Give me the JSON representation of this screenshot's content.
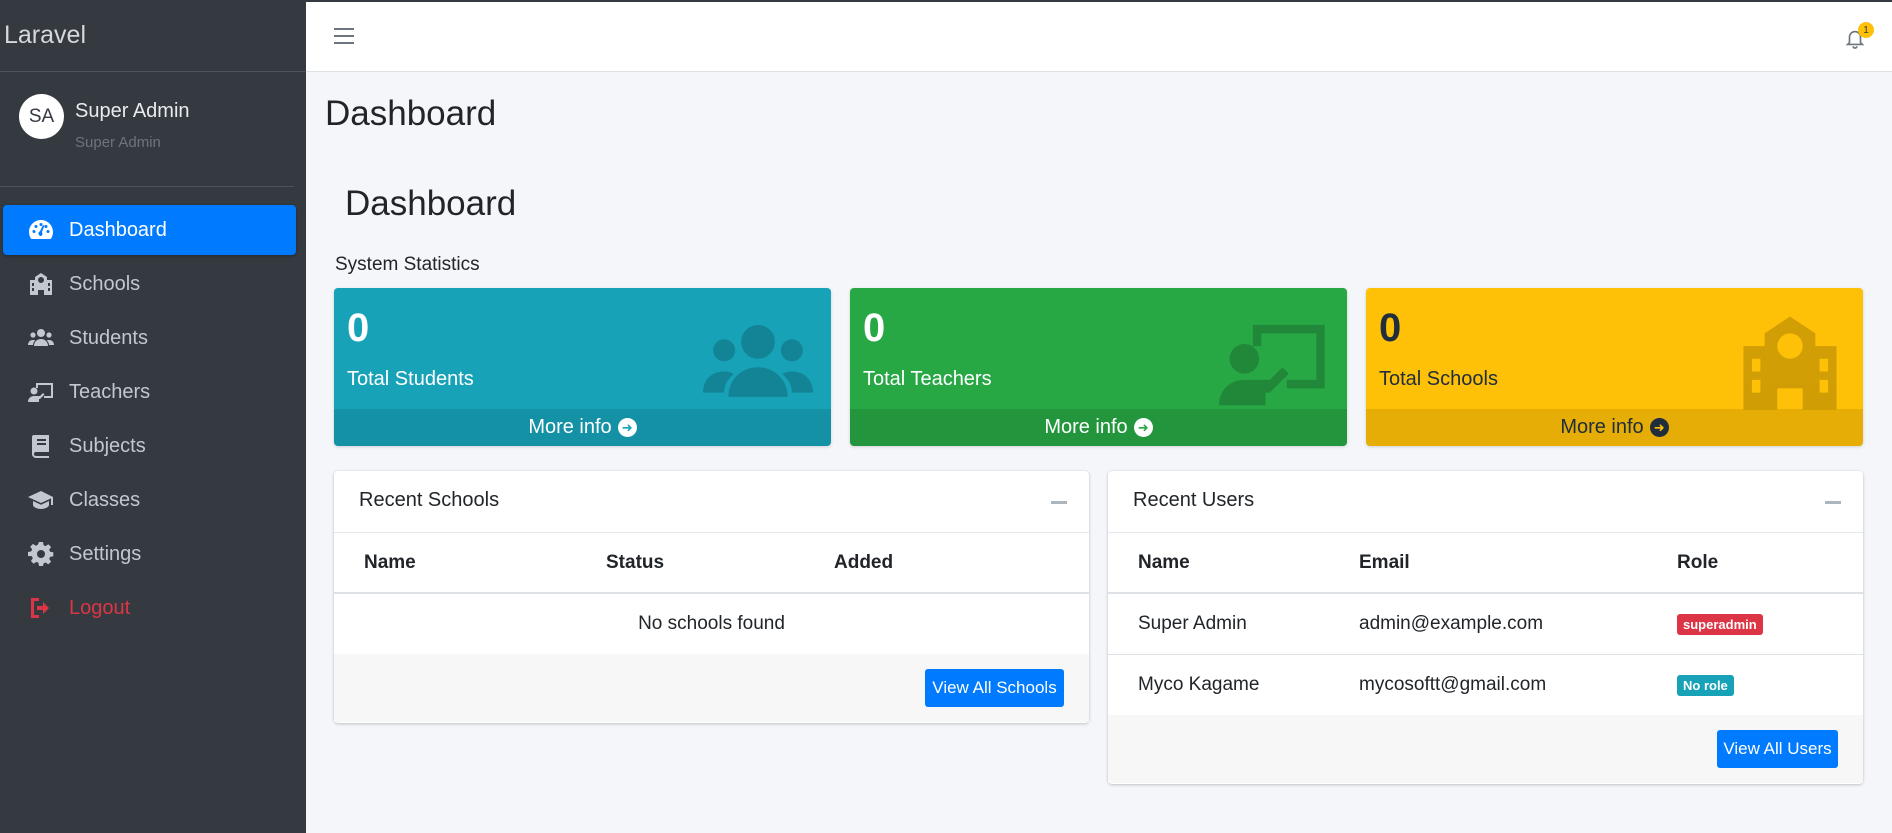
{
  "brand": "Laravel",
  "user": {
    "initials": "SA",
    "name": "Super Admin",
    "role": "Super Admin"
  },
  "nav": [
    {
      "label": "Dashboard",
      "icon": "tachometer-icon"
    },
    {
      "label": "Schools",
      "icon": "school-icon"
    },
    {
      "label": "Students",
      "icon": "users-icon"
    },
    {
      "label": "Teachers",
      "icon": "chalkboard-teacher-icon"
    },
    {
      "label": "Subjects",
      "icon": "book-icon"
    },
    {
      "label": "Classes",
      "icon": "graduation-cap-icon"
    },
    {
      "label": "Settings",
      "icon": "gear-icon"
    },
    {
      "label": "Logout",
      "icon": "sign-out-icon"
    }
  ],
  "topbar": {
    "notification_count": "1"
  },
  "page": {
    "title": "Dashboard",
    "section_title": "Dashboard",
    "stats_label": "System Statistics"
  },
  "stats": [
    {
      "value": "0",
      "label": "Total Students",
      "footer": "More info",
      "icon": "users-icon",
      "color": "#17a2b8"
    },
    {
      "value": "0",
      "label": "Total Teachers",
      "footer": "More info",
      "icon": "chalkboard-teacher-icon",
      "color": "#28a745"
    },
    {
      "value": "0",
      "label": "Total Schools",
      "footer": "More info",
      "icon": "school-icon",
      "color": "#ffc107"
    }
  ],
  "recent_schools": {
    "title": "Recent Schools",
    "columns": [
      "Name",
      "Status",
      "Added"
    ],
    "empty": "No schools found",
    "button": "View All Schools"
  },
  "recent_users": {
    "title": "Recent Users",
    "columns": [
      "Name",
      "Email",
      "Role"
    ],
    "rows": [
      {
        "name": "Super Admin",
        "email": "admin@example.com",
        "role": "superadmin",
        "role_color": "#dc3545"
      },
      {
        "name": "Myco Kagame",
        "email": "mycosoftt@gmail.com",
        "role": "No role",
        "role_color": "#17a2b8"
      }
    ],
    "button": "View All Users"
  },
  "colors": {
    "primary": "#007bff",
    "sidebar": "#343a40",
    "danger": "#dc3545"
  }
}
